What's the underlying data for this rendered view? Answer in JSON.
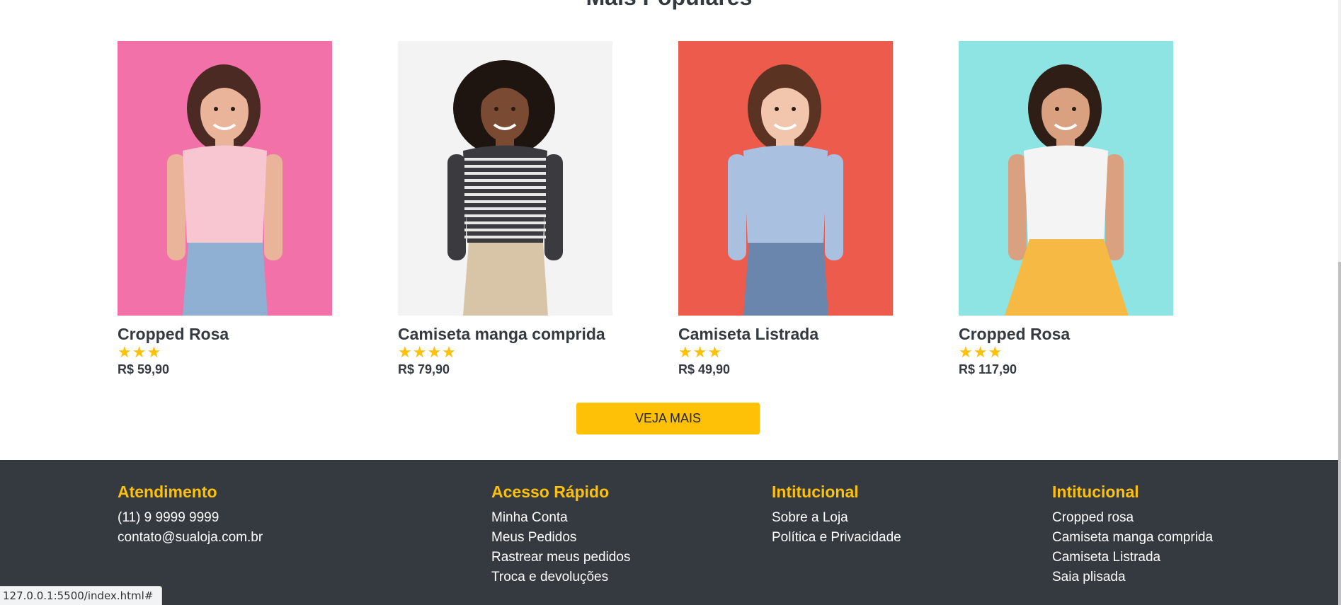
{
  "section": {
    "title": "Mais Populares"
  },
  "products": [
    {
      "name": "Cropped Rosa",
      "stars": "★★★",
      "rating": 3,
      "price": "R$ 59,90",
      "bg": "#f271a9",
      "top": "#f7c6d1",
      "bottom": "#8fb0d3",
      "skin": "#e9b49a",
      "hair": "#4a2a22"
    },
    {
      "name": "Camiseta manga comprida",
      "stars": "★★★★",
      "rating": 4,
      "price": "R$ 79,90",
      "bg": "#f3f3f4",
      "top": "#3a3a3f",
      "bottom": "#d8c5a8",
      "skin": "#7a4a32",
      "hair": "#1e1410"
    },
    {
      "name": "Camiseta Listrada",
      "stars": "★★★",
      "rating": 3,
      "price": "R$ 49,90",
      "bg": "#ec5b4c",
      "top": "#a9c0e0",
      "bottom": "#6a86ad",
      "skin": "#f1c6ad",
      "hair": "#5a3322"
    },
    {
      "name": "Cropped Rosa",
      "stars": "★★★",
      "rating": 3,
      "price": "R$ 117,90",
      "bg": "#8ee3e3",
      "top": "#f4f4f4",
      "bottom": "#f6b943",
      "skin": "#d9a17f",
      "hair": "#2e1e16"
    }
  ],
  "more_button": {
    "label": "VEJA MAIS"
  },
  "footer": {
    "columns": [
      {
        "title": "Atendimento",
        "links": [
          "(11) 9 9999 9999",
          "contato@sualoja.com.br"
        ]
      },
      {
        "title": "Acesso Rápido",
        "links": [
          "Minha Conta",
          "Meus Pedidos",
          "Rastrear meus pedidos",
          "Troca e devoluções"
        ]
      },
      {
        "title": "Intitucional",
        "links": [
          "Sobre a Loja",
          "Política e Privacidade"
        ]
      },
      {
        "title": "Intitucional",
        "links": [
          "Cropped rosa",
          "Camiseta manga comprida",
          "Camiseta Listrada",
          "Saia plisada"
        ]
      }
    ]
  },
  "status": {
    "url": "127.0.0.1:5500/index.html#"
  },
  "colors": {
    "accent": "#ffc107",
    "footer_bg": "#343a40",
    "text": "#343a40"
  }
}
